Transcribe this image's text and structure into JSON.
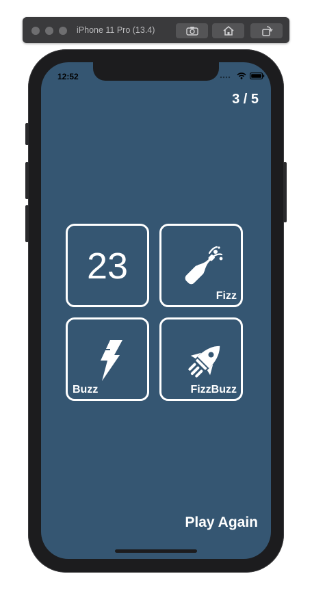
{
  "simulator": {
    "title": "iPhone 11 Pro (13.4)",
    "buttons": [
      "screenshot-icon",
      "home-icon",
      "rotate-icon"
    ]
  },
  "status_bar": {
    "time": "12:52",
    "icons": [
      "signal-icon",
      "wifi-icon",
      "battery-icon"
    ]
  },
  "game": {
    "score": "3 / 5",
    "tiles": [
      {
        "text": "23",
        "icon": null
      },
      {
        "label": "Fizz",
        "icon": "champagne-bottle-icon"
      },
      {
        "label": "Buzz",
        "icon": "lightning-bolt-icon"
      },
      {
        "label": "FizzBuzz",
        "icon": "rocket-icon"
      }
    ],
    "play_again": "Play Again"
  },
  "colors": {
    "screen_background": "#355672",
    "tile_border": "#ffffff",
    "text": "#ffffff"
  }
}
